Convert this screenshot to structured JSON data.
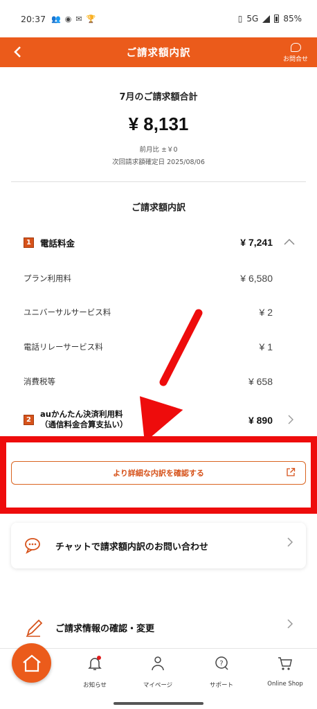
{
  "status_bar": {
    "time": "20:37",
    "network": "5G",
    "battery": "85%"
  },
  "header": {
    "back_icon": "chevron-left-icon",
    "title": "ご請求額内訳",
    "contact_label": "お問合せ"
  },
  "summary": {
    "title": "7月のご請求額合計",
    "amount": "¥ 8,131",
    "prev_month": "前月比 ±￥0",
    "next_confirm": "次回請求額確定日 2025/08/06"
  },
  "breakdown": {
    "title": "ご請求額内訳",
    "item1": {
      "badge": "1",
      "name": "電話料金",
      "amount": "¥ 7,241"
    },
    "sub_items": [
      {
        "name": "プラン利用料",
        "amount": "¥ 6,580"
      },
      {
        "name": "ユニバーサルサービス料",
        "amount": "¥ 2"
      },
      {
        "name": "電話リレーサービス料",
        "amount": "¥ 1"
      },
      {
        "name": "消費税等",
        "amount": "¥ 658"
      }
    ],
    "item2": {
      "badge": "2",
      "name_line1": "auかんたん決済利用料",
      "name_line2": "（通信料金合算支払い）",
      "amount": "¥ 890"
    }
  },
  "detail_button": {
    "label": "より詳細な内訳を確認する"
  },
  "chat_card": {
    "label": "チャットで請求額内訳のお問い合わせ"
  },
  "info_row": {
    "label": "ご請求情報の確認・変更"
  },
  "bottom_nav": [
    {
      "label": "お知らせ",
      "icon": "bell-icon"
    },
    {
      "label": "マイページ",
      "icon": "person-icon"
    },
    {
      "label": "サポート",
      "icon": "support-icon"
    },
    {
      "label": "Online Shop",
      "icon": "cart-icon"
    }
  ],
  "colors": {
    "accent": "#eb5b1b",
    "highlight": "#ee0c0c",
    "badge": "#d6521a"
  }
}
